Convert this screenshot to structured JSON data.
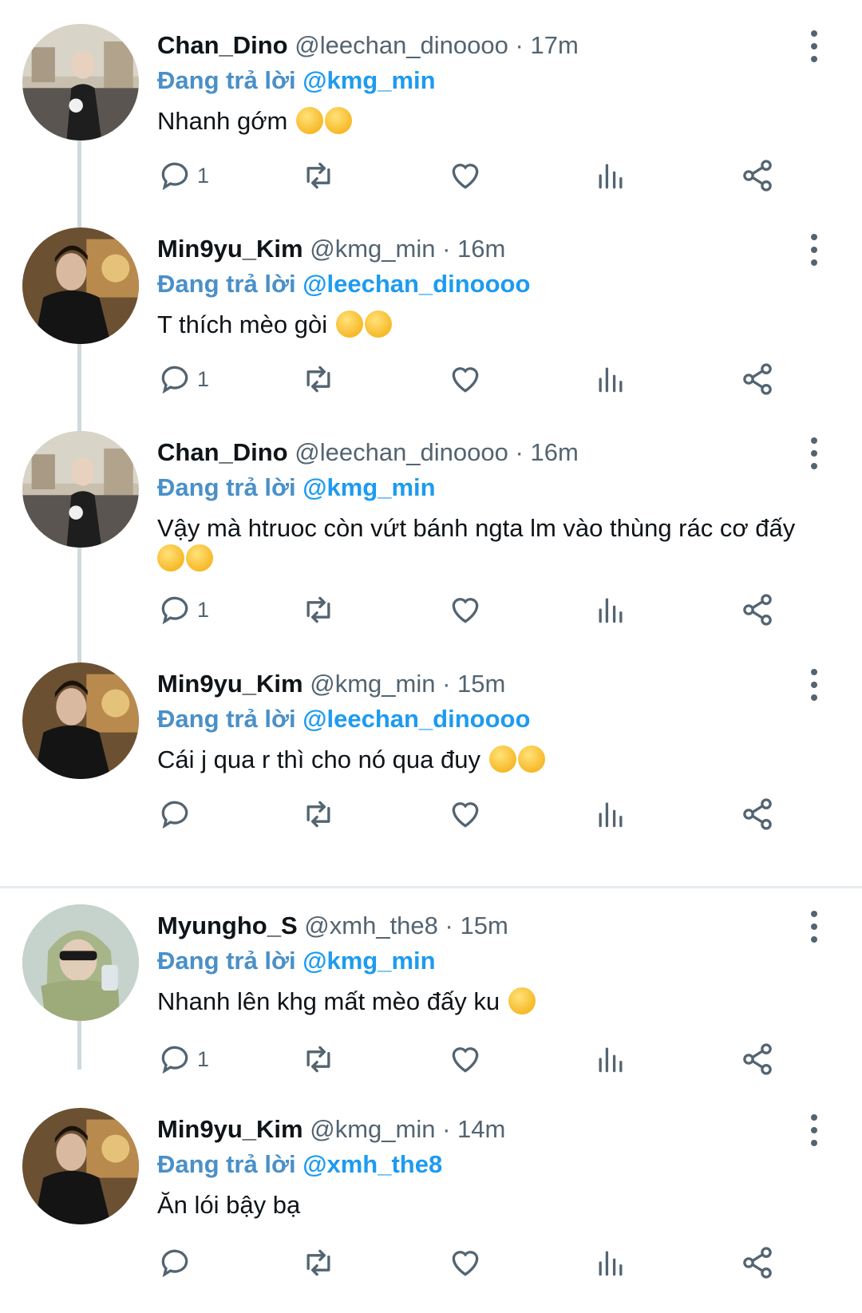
{
  "colors": {
    "accent": "#1d9bf0",
    "secondary_text": "#536471",
    "thread_line": "#cfd9de"
  },
  "tweets": [
    {
      "name": "Chan_Dino",
      "handle": "@leechan_dinoooo",
      "time": "17m",
      "reply_prefix": "Đang trả lời",
      "reply_to": "@kmg_min",
      "text": "Nhanh gớm",
      "emojis": 2,
      "reply_count": "1"
    },
    {
      "name": "Min9yu_Kim",
      "handle": "@kmg_min",
      "time": "16m",
      "reply_prefix": "Đang trả lời",
      "reply_to": "@leechan_dinoooo",
      "text": "T thích mèo gòi",
      "emojis": 2,
      "reply_count": "1"
    },
    {
      "name": "Chan_Dino",
      "handle": "@leechan_dinoooo",
      "time": "16m",
      "reply_prefix": "Đang trả lời",
      "reply_to": "@kmg_min",
      "text": "Vậy mà htruoc còn vứt bánh ngta lm vào thùng rác cơ đấy",
      "emojis": 2,
      "reply_count": "1"
    },
    {
      "name": "Min9yu_Kim",
      "handle": "@kmg_min",
      "time": "15m",
      "reply_prefix": "Đang trả lời",
      "reply_to": "@leechan_dinoooo",
      "text": "Cái j qua r thì cho nó qua đuy",
      "emojis": 2,
      "reply_count": ""
    },
    {
      "name": "Myungho_S",
      "handle": "@xmh_the8",
      "time": "15m",
      "reply_prefix": "Đang trả lời",
      "reply_to": "@kmg_min",
      "text": "Nhanh lên khg mất mèo đấy ku",
      "emojis": 1,
      "reply_count": "1"
    },
    {
      "name": "Min9yu_Kim",
      "handle": "@kmg_min",
      "time": "14m",
      "reply_prefix": "Đang trả lời",
      "reply_to": "@xmh_the8",
      "text": "Ăn lói bậy bạ",
      "emojis": 0,
      "reply_count": ""
    }
  ],
  "icons": {
    "reply": "reply-icon",
    "retweet": "retweet-icon",
    "like": "heart-icon",
    "views": "views-icon",
    "share": "share-icon",
    "more": "more-icon"
  }
}
